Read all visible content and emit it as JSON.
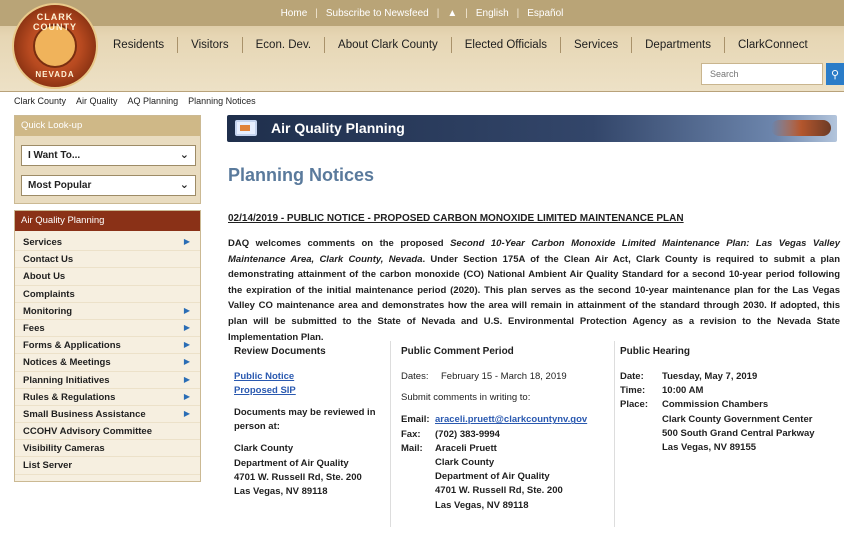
{
  "topbar": {
    "home": "Home",
    "subscribe": "Subscribe to Newsfeed",
    "lock_icon": "lock-icon",
    "english": "English",
    "espanol": "Español"
  },
  "logo": {
    "top_text": "CLARK COUNTY",
    "bottom_text": "NEVADA"
  },
  "nav": {
    "items": [
      "Residents",
      "Visitors",
      "Econ. Dev.",
      "About Clark County",
      "Elected Officials",
      "Services",
      "Departments",
      "ClarkConnect"
    ]
  },
  "search": {
    "placeholder": "Search",
    "icon": "search-icon"
  },
  "breadcrumb": [
    "Clark County",
    "Air Quality",
    "AQ Planning",
    "Planning Notices"
  ],
  "quick_lookup": {
    "title": "Quick Look-up",
    "dropdown1": "I Want To...",
    "dropdown2": "Most Popular"
  },
  "aqp_menu": {
    "title": "Air Quality Planning",
    "items": [
      {
        "label": "Services",
        "has_arrow": true
      },
      {
        "label": "Contact Us",
        "has_arrow": false
      },
      {
        "label": "About Us",
        "has_arrow": false
      },
      {
        "label": "Complaints",
        "has_arrow": false
      },
      {
        "label": "Monitoring",
        "has_arrow": true
      },
      {
        "label": "Fees",
        "has_arrow": true
      },
      {
        "label": "Forms & Applications",
        "has_arrow": true
      },
      {
        "label": "Notices & Meetings",
        "has_arrow": true
      },
      {
        "label": "Planning Initiatives",
        "has_arrow": true
      },
      {
        "label": "Rules & Regulations",
        "has_arrow": true
      },
      {
        "label": "Small Business Assistance",
        "has_arrow": true
      },
      {
        "label": "CCOHV Advisory Committee",
        "has_arrow": false
      },
      {
        "label": "Visibility Cameras",
        "has_arrow": false
      },
      {
        "label": "List Server",
        "has_arrow": false
      }
    ]
  },
  "banner": {
    "title": "Air Quality Planning"
  },
  "page": {
    "title": "Planning Notices",
    "notice_title": "02/14/2019 - PUBLIC NOTICE - PROPOSED CARBON MONOXIDE LIMITED MAINTENANCE PLAN",
    "notice_body_prefix": "DAQ welcomes comments on the proposed ",
    "notice_body_italic": "Second 10-Year Carbon Monoxide Limited Maintenance Plan: Las Vegas Valley Maintenance Area, Clark County, Nevada",
    "notice_body_rest": ". Under Section 175A of the Clean Air Act, Clark County is required to submit a plan demonstrating attainment of the carbon monoxide (CO) National Ambient Air Quality Standard for a second 10-year period following the expiration of the initial maintenance period (2020). This plan serves as the second 10-year maintenance plan for the Las Vegas Valley CO maintenance area and demonstrates how the area will remain in attainment of the standard through 2030. If adopted, this plan will be submitted to the State of Nevada and U.S. Environmental Protection Agency as a revision to the Nevada State Implementation Plan."
  },
  "review": {
    "heading": "Review Documents",
    "link1": "Public Notice",
    "link2": "Proposed SIP",
    "note": "Documents may be reviewed in person at:",
    "addr": [
      "Clark County",
      "Department of Air Quality",
      "4701 W. Russell Rd, Ste. 200",
      "Las Vegas, NV 89118"
    ]
  },
  "comment": {
    "heading": "Public Comment Period",
    "dates_label": "Dates:",
    "dates_value": "February 15 - March 18, 2019",
    "submit_note": "Submit comments in writing to:",
    "email_label": "Email:",
    "email_value": "araceli.pruett@clarkcountynv.gov",
    "fax_label": "Fax:",
    "fax_value": "(702) 383-9994",
    "mail_label": "Mail:",
    "mail_lines": [
      "Araceli Pruett",
      "Clark County",
      "Department of Air Quality",
      "4701 W. Russell Rd, Ste. 200",
      "Las Vegas, NV 89118"
    ]
  },
  "hearing": {
    "heading": "Public Hearing",
    "date_label": "Date:",
    "date_value": "Tuesday, May 7, 2019",
    "time_label": "Time:",
    "time_value": "10:00 AM",
    "place_label": "Place:",
    "place_lines": [
      "Commission Chambers",
      "Clark County Government Center",
      "500 South Grand Central Parkway",
      "Las Vegas, NV 89155"
    ]
  }
}
